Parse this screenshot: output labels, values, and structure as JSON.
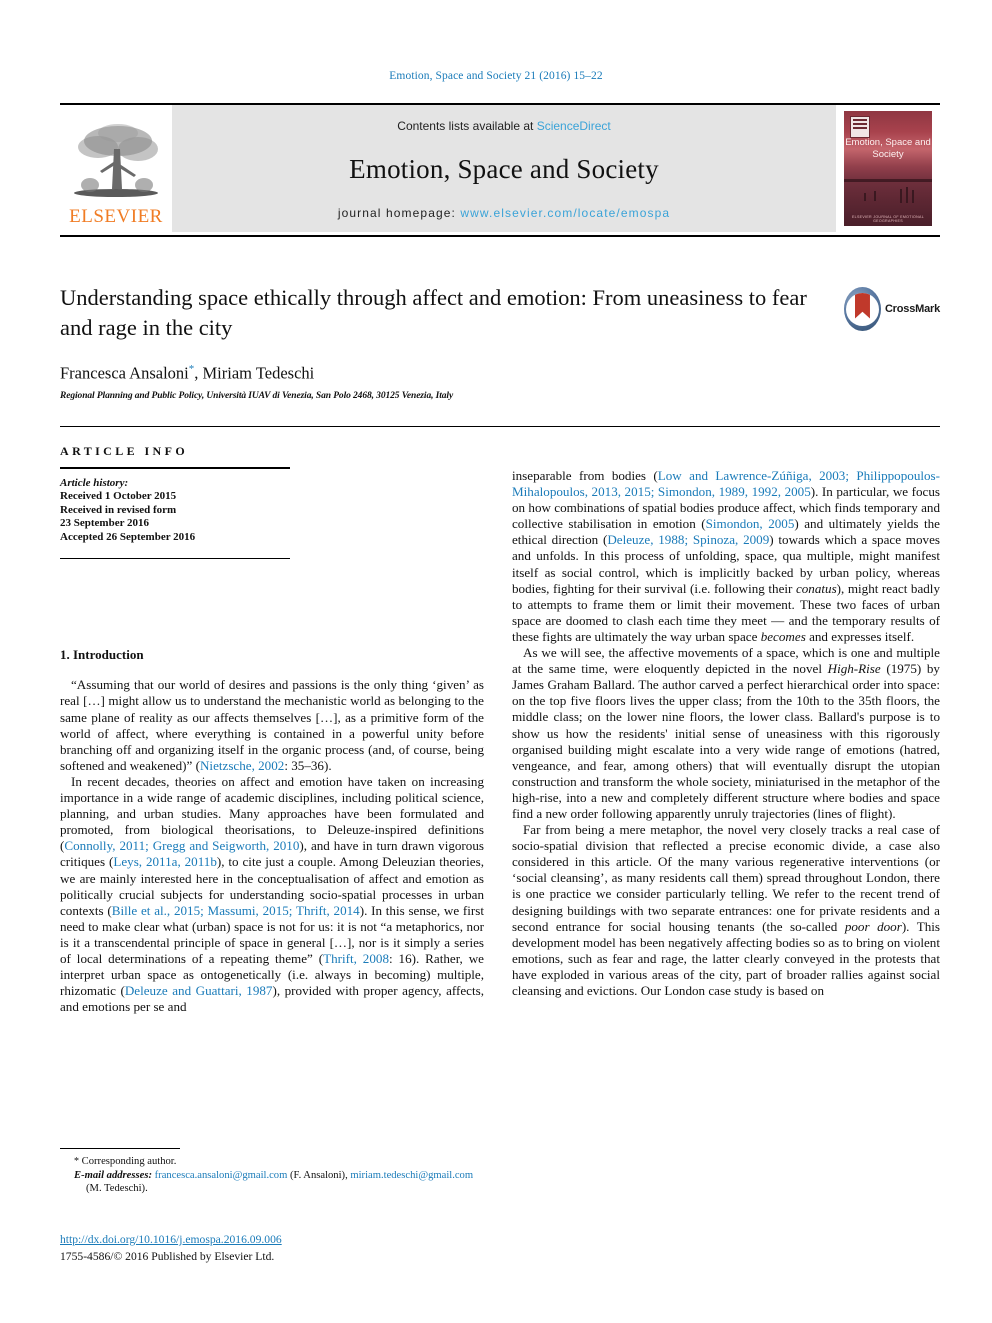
{
  "running_head": "Emotion, Space and Society 21 (2016) 15–22",
  "masthead": {
    "publisher_logo_label": "ELSEVIER",
    "contents_prefix": "Contents lists available at ",
    "contents_link": "ScienceDirect",
    "journal_title": "Emotion, Space and Society",
    "homepage_prefix": "journal homepage: ",
    "homepage_url": "www.elsevier.com/locate/emospa",
    "cover": {
      "title": "Emotion, Space and Society",
      "footer": "ELSEVIER JOURNAL OF EMOTIONAL GEOGRAPHIES"
    }
  },
  "article": {
    "title": "Understanding space ethically through affect and emotion: From uneasiness to fear and rage in the city",
    "authors": "Francesca Ansaloni",
    "authors_rest": ", Miriam Tedeschi",
    "corresponding_marker": "*",
    "affiliation": "Regional Planning and Public Policy, Università IUAV di Venezia, San Polo 2468, 30125 Venezia, Italy",
    "crossmark_label": "CrossMark"
  },
  "article_info": {
    "heading": "ARTICLE INFO",
    "history_label": "Article history:",
    "history_lines": [
      "Received 1 October 2015",
      "Received in revised form",
      "23 September 2016",
      "Accepted 26 September 2016"
    ]
  },
  "sections": {
    "introduction_heading": "1. Introduction"
  },
  "left_column_paragraphs": [
    {
      "id": "p-nietzsche-quote",
      "runs": [
        {
          "t": "“Assuming that our world of desires and passions is the only thing ‘given’ as real […] might allow us to understand the mechanistic world as belonging to the same plane of reality as our affects themselves […], as a primitive form of the world of affect, where everything is contained in a powerful unity before branching off and organizing itself in the organic process (and, of course, being softened and weakened)” (",
          "s": "plain"
        },
        {
          "t": "Nietzsche, 2002",
          "s": "ref"
        },
        {
          "t": ": 35–36).",
          "s": "plain"
        }
      ]
    },
    {
      "id": "p-recent-decades",
      "runs": [
        {
          "t": "In recent decades, theories on affect and emotion have taken on increasing importance in a wide range of academic disciplines, including political science, planning, and urban studies. Many approaches have been formulated and promoted, from biological theorisations, to Deleuze-inspired definitions (",
          "s": "plain"
        },
        {
          "t": "Connolly, 2011; Gregg and Seigworth, 2010",
          "s": "ref"
        },
        {
          "t": "), and have in turn drawn vigorous critiques (",
          "s": "plain"
        },
        {
          "t": "Leys, 2011a, 2011b",
          "s": "ref"
        },
        {
          "t": "), to cite just a couple. Among Deleuzian theories, we are mainly interested here in the conceptualisation of affect and emotion as politically crucial subjects for understanding socio-spatial processes in urban contexts (",
          "s": "plain"
        },
        {
          "t": "Bille et al., 2015; Massumi, 2015; Thrift, 2014",
          "s": "ref"
        },
        {
          "t": "). In this sense, we first need to make clear what (urban) space is not for us: it is not “a metaphorics, nor is it a transcendental principle of space in general […], nor is it simply a series of local determinations of a repeating theme” (",
          "s": "plain"
        },
        {
          "t": "Thrift, 2008",
          "s": "ref"
        },
        {
          "t": ": 16). Rather, we interpret urban space as ontogenetically (i.e. always in becoming) multiple, rhizomatic (",
          "s": "plain"
        },
        {
          "t": "Deleuze and Guattari, 1987",
          "s": "ref"
        },
        {
          "t": "), provided with proper agency, affects, and emotions per se and",
          "s": "plain"
        }
      ]
    }
  ],
  "right_column_paragraphs": [
    {
      "id": "p-inseparable",
      "indent": false,
      "runs": [
        {
          "t": "inseparable from bodies (",
          "s": "plain"
        },
        {
          "t": "Low and Lawrence-Zúñiga, 2003; Philippopoulos-Mihalopoulos, 2013, 2015; Simondon, 1989, 1992, 2005",
          "s": "ref"
        },
        {
          "t": "). In particular, we focus on how combinations of spatial bodies produce affect, which finds temporary and collective stabilisation in emotion (",
          "s": "plain"
        },
        {
          "t": "Simondon, 2005",
          "s": "ref"
        },
        {
          "t": ") and ultimately yields the ethical direction (",
          "s": "plain"
        },
        {
          "t": "Deleuze, 1988; Spinoza, 2009",
          "s": "ref"
        },
        {
          "t": ") towards which a space moves and unfolds. In this process of unfolding, space, qua multiple, might manifest itself as social control, which is implicitly backed by urban policy, whereas bodies, fighting for their survival (i.e. following their ",
          "s": "plain"
        },
        {
          "t": "conatus",
          "s": "ital"
        },
        {
          "t": "), might react badly to attempts to frame them or limit their movement. These two faces of urban space are doomed to clash each time they meet — and the temporary results of these fights are ultimately the way urban space ",
          "s": "plain"
        },
        {
          "t": "becomes",
          "s": "ital"
        },
        {
          "t": " and expresses itself.",
          "s": "plain"
        }
      ]
    },
    {
      "id": "p-as-we-will-see",
      "indent": true,
      "runs": [
        {
          "t": "As we will see, the affective movements of a space, which is one and multiple at the same time, were eloquently depicted in the novel ",
          "s": "plain"
        },
        {
          "t": "High-Rise",
          "s": "ital"
        },
        {
          "t": " (1975) by James Graham Ballard. The author carved a perfect hierarchical order into space: on the top five floors lives the upper class; from the 10th to the 35th floors, the middle class; on the lower nine floors, the lower class. Ballard's purpose is to show us how the residents' initial sense of uneasiness with this rigorously organised building might escalate into a very wide range of emotions (hatred, vengeance, and fear, among others) that will eventually disrupt the utopian construction and transform the whole society, miniaturised in the metaphor of the high-rise, into a new and completely different structure where bodies and space find a new order following apparently unruly trajectories (lines of flight).",
          "s": "plain"
        }
      ]
    },
    {
      "id": "p-far-from-being",
      "indent": true,
      "runs": [
        {
          "t": "Far from being a mere metaphor, the novel very closely tracks a real case of socio-spatial division that reflected a precise economic divide, a case also considered in this article. Of the many various regenerative interventions (or ‘social cleansing’, as many residents call them) spread throughout London, there is one practice we consider particularly telling. We refer to the recent trend of designing buildings with two separate entrances: one for private residents and a second entrance for social housing tenants (the so-called ",
          "s": "plain"
        },
        {
          "t": "poor door",
          "s": "ital"
        },
        {
          "t": "). This development model has been negatively affecting bodies so as to bring on violent emotions, such as fear and rage, the latter clearly conveyed in the protests that have exploded in various areas of the city, part of broader rallies against social cleansing and evictions. Our London case study is based on",
          "s": "plain"
        }
      ]
    }
  ],
  "footnotes": {
    "corresponding": "Corresponding author.",
    "email_label": "E-mail addresses:",
    "email_1": "francesca.ansaloni@gmail.com",
    "email_1_owner": " (F. Ansaloni), ",
    "email_2": "miriam.tedeschi@gmail.com",
    "email_2_owner": " (M. Tedeschi)."
  },
  "footer": {
    "doi": "http://dx.doi.org/10.1016/j.emospa.2016.09.006",
    "copyright": "1755-4586/© 2016 Published by Elsevier Ltd."
  },
  "colors": {
    "link": "#1a7bb9",
    "elsevier_orange": "#f07c24",
    "masthead_bg": "#e4e4e4",
    "cover_red": "#8f3742"
  }
}
